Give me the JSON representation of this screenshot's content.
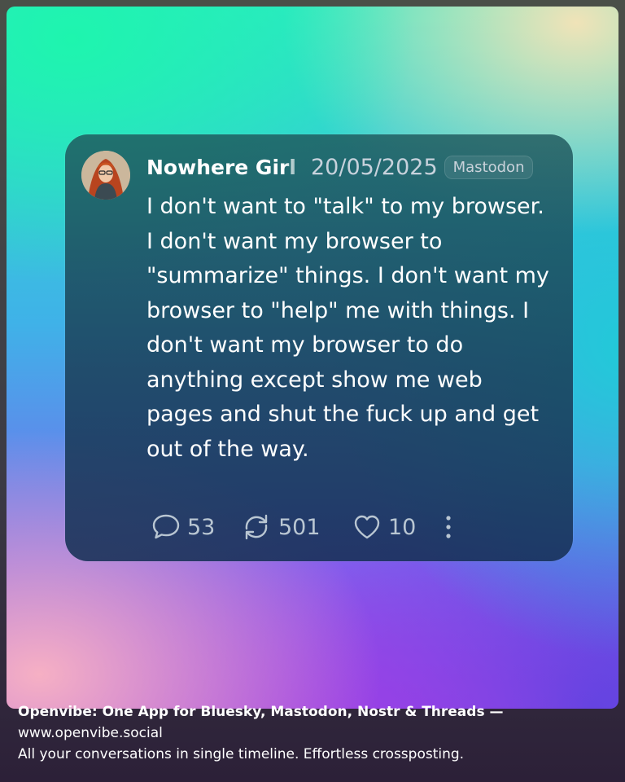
{
  "post": {
    "author": "Nowhere Girl",
    "date": "20/05/2025",
    "platform": "Mastodon",
    "text": "I don't want to \"talk\" to my browser. I don't want my browser to \"summarize\" things. I don't want my browser to \"help\" me with things. I don't want my browser to do anything except show me web pages and shut the fuck up and get out of the way.",
    "stats": {
      "replies": "53",
      "boosts": "501",
      "likes": "10"
    }
  },
  "icons": {
    "reply": "speech-bubble-icon",
    "boost": "repost-arrows-icon",
    "like": "heart-icon",
    "more": "vertical-ellipsis-icon"
  },
  "footer": {
    "line1": "Openvibe: One App for Bluesky, Mastodon, Nostr & Threads —",
    "line2": "www.openvibe.social",
    "line3": "All your conversations in single timeline. Effortless crossposting."
  },
  "colors": {
    "card": "#1e4a5a",
    "text": "#ffffff",
    "muted": "#b9c6d2"
  }
}
